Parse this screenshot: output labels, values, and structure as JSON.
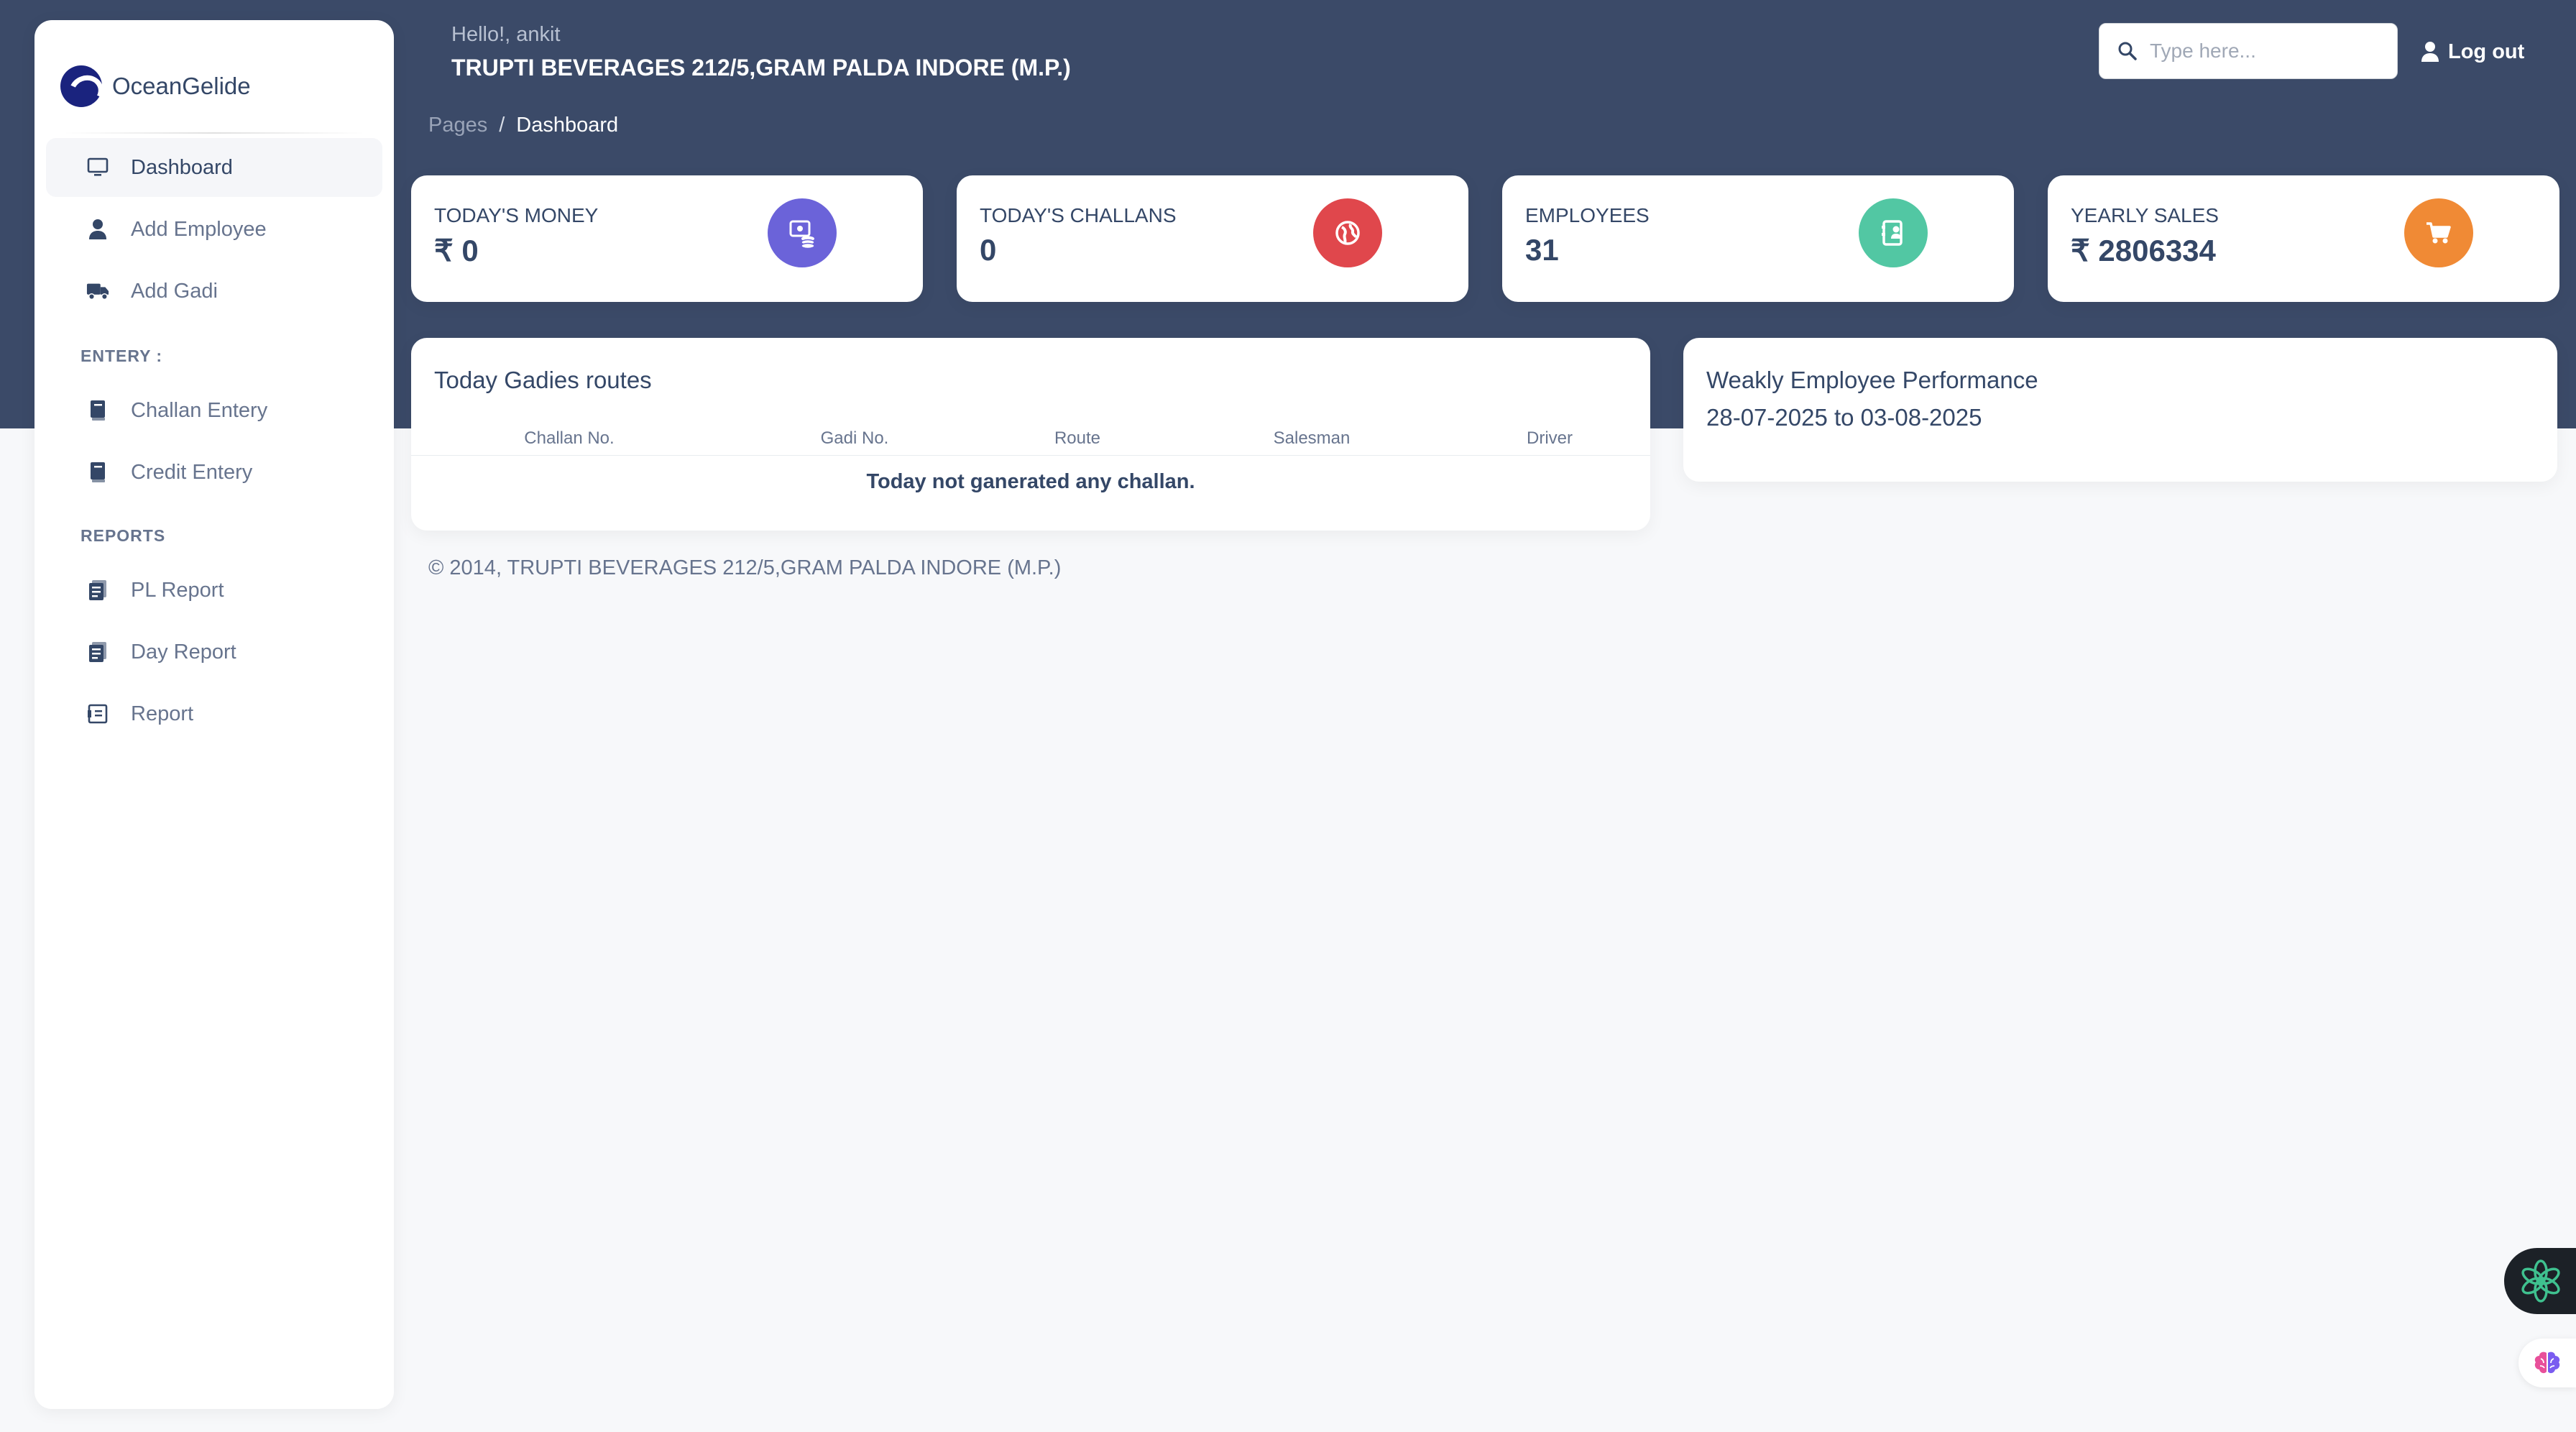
{
  "brand": {
    "name": "OceanGelide",
    "logo_icon": "wave-logo-icon"
  },
  "sidebar": {
    "items": [
      {
        "label": "Dashboard",
        "icon": "monitor-icon",
        "active": true
      },
      {
        "label": "Add Employee",
        "icon": "user-icon"
      },
      {
        "label": "Add Gadi",
        "icon": "truck-icon"
      }
    ],
    "entery_section": "ENTERY :",
    "entery_items": [
      {
        "label": "Challan Entery",
        "icon": "book-icon"
      },
      {
        "label": "Credit Entery",
        "icon": "book-icon"
      }
    ],
    "reports_section": "REPORTS",
    "report_items": [
      {
        "label": "PL Report",
        "icon": "report-doc-icon"
      },
      {
        "label": "Day Report",
        "icon": "report-doc-icon"
      },
      {
        "label": "Report",
        "icon": "receipt-icon"
      }
    ]
  },
  "header": {
    "greeting": "Hello!, ankit",
    "company": "TRUPTI BEVERAGES 212/5,GRAM PALDA INDORE (M.P.)",
    "breadcrumb": {
      "pages": "Pages",
      "separator": "/",
      "current": "Dashboard"
    },
    "search_placeholder": "Type here...",
    "logout": "Log out"
  },
  "cards": [
    {
      "label": "Today's Money",
      "value": "₹ 0",
      "icon": "money-icon",
      "color": "#6b63d9"
    },
    {
      "label": "Today's Challans",
      "value": "0",
      "icon": "globe-icon",
      "color": "#e0474c"
    },
    {
      "label": "Employees",
      "value": "31",
      "icon": "contact-icon",
      "color": "#52c7a3"
    },
    {
      "label": "Yearly Sales",
      "value": "₹ 2806334",
      "icon": "cart-icon",
      "color": "#f08a35"
    }
  ],
  "routes": {
    "title": "Today Gadies routes",
    "columns": [
      "Challan No.",
      "Gadi No.",
      "Route",
      "Salesman",
      "Driver"
    ],
    "empty_message": "Today not ganerated any challan."
  },
  "performance": {
    "title": "Weakly Employee Performance",
    "range": "28-07-2025 to 03-08-2025"
  },
  "footer": "© 2014, TRUPTI BEVERAGES 212/5,GRAM PALDA INDORE (M.P.)",
  "colors": {
    "header_bg": "#3b4a68",
    "page_bg": "#f7f8fa",
    "text": "#344767"
  }
}
